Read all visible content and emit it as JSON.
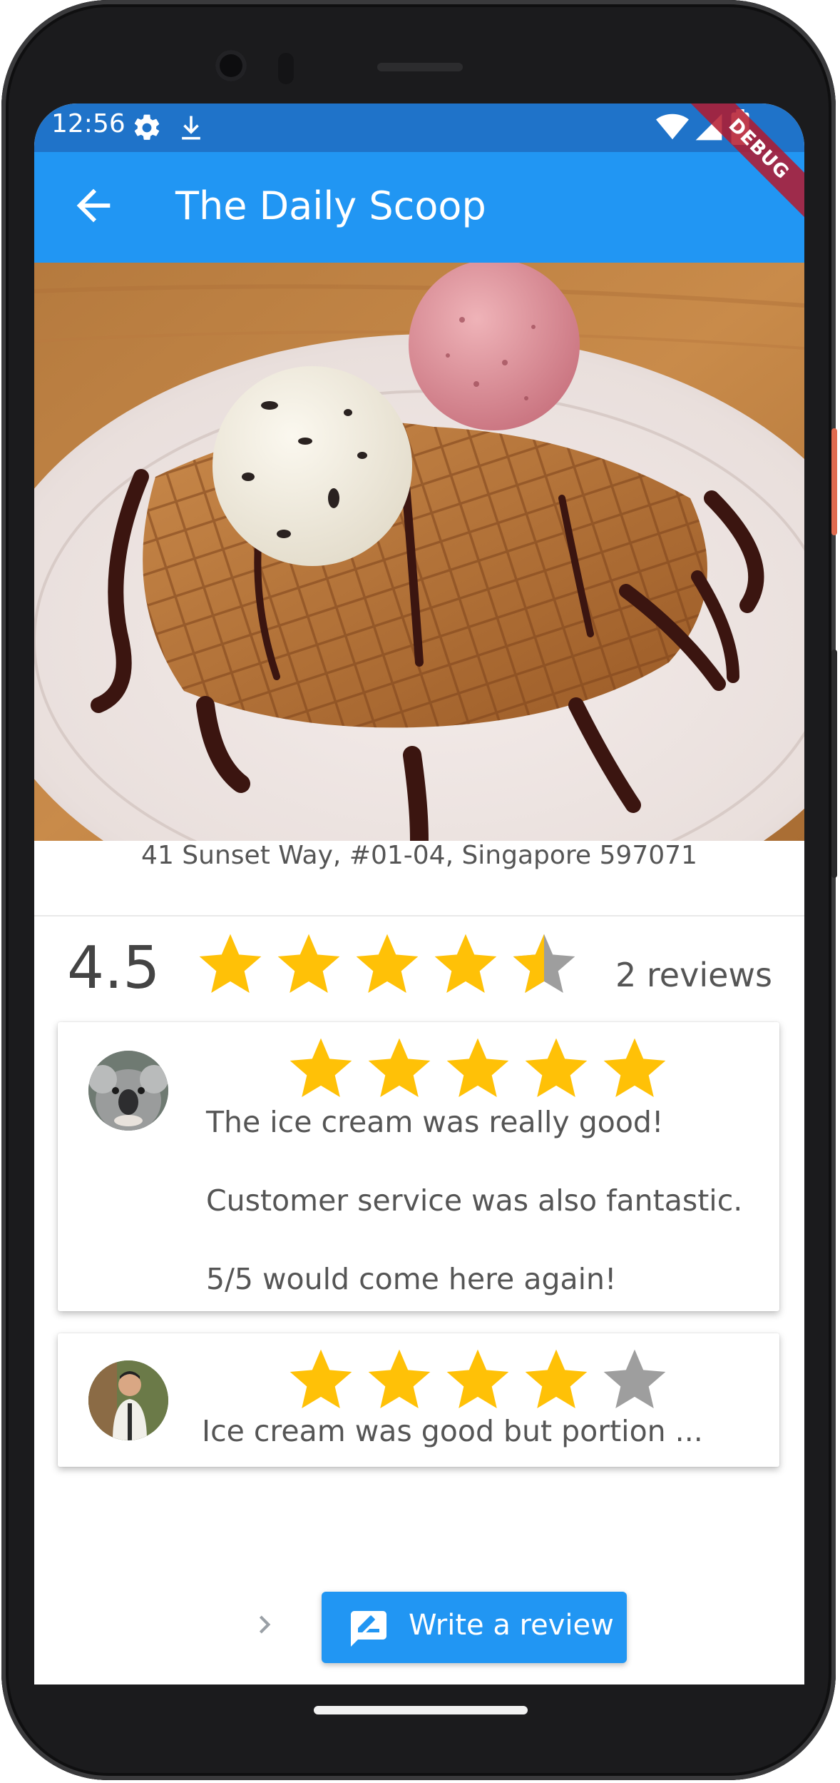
{
  "status_bar": {
    "time": "12:56",
    "icons": [
      "settings-icon",
      "download-icon",
      "wifi-icon",
      "signal-icon",
      "battery-icon"
    ]
  },
  "debug_banner": "DEBUG",
  "app_bar": {
    "title": "The Daily Scoop",
    "back_icon": "arrow-back-icon",
    "background": "#2196f3"
  },
  "shop": {
    "address": "41 Sunset Way, #01-04, Singapore 597071",
    "average_rating": "4.5",
    "rating_value": 4.5,
    "review_count_label": "2 reviews"
  },
  "reviews": [
    {
      "avatar": "koala-avatar",
      "rating": 5,
      "lines": [
        "The ice cream was really good!",
        "Customer service was also fantastic.",
        "5/5 would come here again!"
      ]
    },
    {
      "avatar": "person-avatar",
      "rating": 4,
      "lines": [
        "Ice cream was good but portion ..."
      ]
    }
  ],
  "actions": {
    "next_icon": "chevron-right-icon",
    "write_review_label": "Write a review",
    "write_review_icon": "rate-review-icon"
  },
  "colors": {
    "star_filled": "#ffc107",
    "star_empty": "#9e9e9e",
    "accent": "#2196f3",
    "status_bar": "#1f73c9"
  }
}
